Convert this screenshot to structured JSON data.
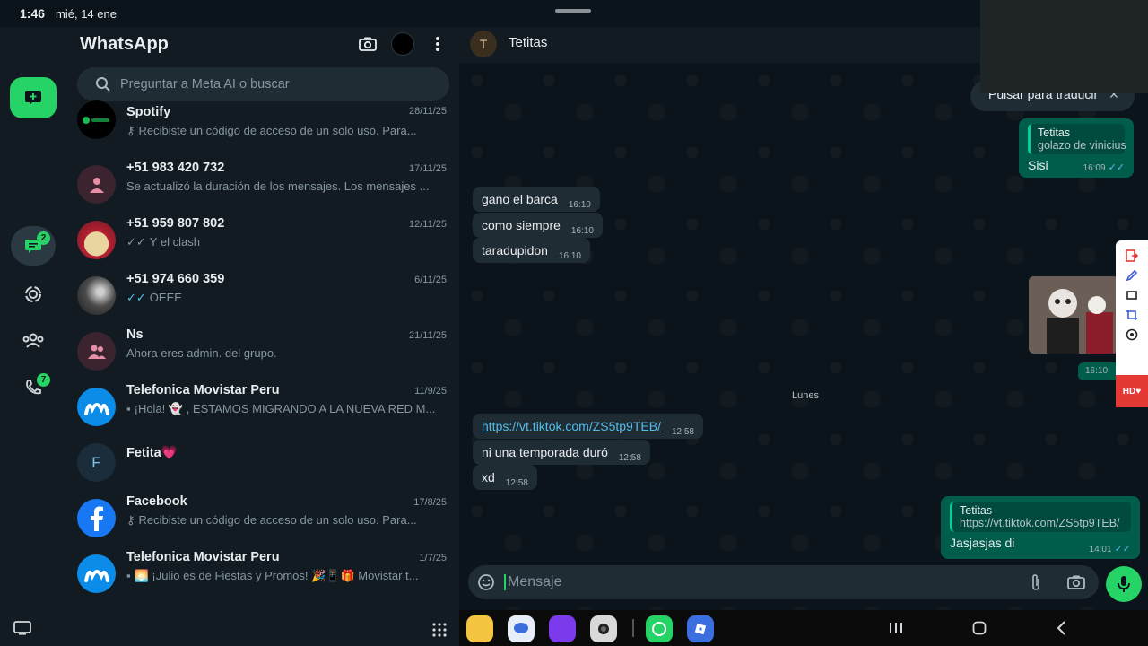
{
  "status_bar": {
    "time": "1:46",
    "date": "mié, 14 ene"
  },
  "app": {
    "title": "WhatsApp"
  },
  "rail": {
    "chats_badge": "2",
    "calls_badge": "7"
  },
  "search": {
    "placeholder": "Preguntar a Meta AI o buscar"
  },
  "chats": [
    {
      "name": "Spotify",
      "date": "28/11/25",
      "preview": "Recibiste un código de acceso de un solo uso. Para...",
      "preview_icon": "key-icon"
    },
    {
      "name": "+51 983 420 732",
      "date": "17/11/25",
      "preview": "Se actualizó la duración de los mensajes. Los mensajes ..."
    },
    {
      "name": "+51 959 807 802",
      "date": "12/11/25",
      "preview": "Y el clash",
      "preview_icon": "double-check-icon"
    },
    {
      "name": "+51 974 660 359",
      "date": "6/11/25",
      "preview": "OEEE",
      "preview_icon": "double-check-icon"
    },
    {
      "name": "Ns",
      "date": "21/11/25",
      "preview": "Ahora eres admin. del grupo."
    },
    {
      "name": "Telefonica Movistar Peru",
      "date": "11/9/25",
      "preview": "¡Hola! 👻 , ESTAMOS MIGRANDO A LA NUEVA RED M...",
      "preview_icon": "image-icon"
    },
    {
      "name": "Fetita💗",
      "date": "",
      "preview": "",
      "avatar_letter": "F"
    },
    {
      "name": "Facebook",
      "date": "17/8/25",
      "preview": "Recibiste un código de acceso de un solo uso. Para...",
      "preview_icon": "key-icon"
    },
    {
      "name": "Telefonica Movistar Peru",
      "date": "1/7/25",
      "preview": "🌅 ¡Julio es de Fiestas y Promos! 🎉📱🎁 Movistar t...",
      "preview_icon": "image-icon"
    }
  ],
  "conversation": {
    "contact_name": "Tetitas",
    "contact_initial": "T",
    "translate_prompt": "Pulsar para traducir",
    "messages": [
      {
        "dir": "out",
        "quote_name": "Tetitas",
        "quote_text": "golazo de vinicius",
        "text": "Sisi",
        "time": "16:09"
      },
      {
        "dir": "in",
        "text": "gano el barca",
        "time": "16:10"
      },
      {
        "dir": "in",
        "text": "como siempre",
        "time": "16:10"
      },
      {
        "dir": "in",
        "text": "taradupidon",
        "time": "16:10"
      },
      {
        "dir": "out",
        "kind": "photo",
        "time": "16:10"
      },
      {
        "dir": "in",
        "text": "https://vt.tiktok.com/ZS5tp9TEB/",
        "time": "12:58",
        "is_link": true
      },
      {
        "dir": "in",
        "text": "ni una temporada duró",
        "time": "12:58"
      },
      {
        "dir": "in",
        "text": "xd",
        "time": "12:58"
      },
      {
        "dir": "out",
        "quote_name": "Tetitas",
        "quote_text": "https://vt.tiktok.com/ZS5tp9TEB/",
        "text": "Jasjasjas di",
        "time": "14:01"
      }
    ],
    "date_separator": "Lunes",
    "input_placeholder": "Mensaje"
  },
  "side_tools": {
    "hd_label": "HD"
  },
  "colors": {
    "accent": "#25d366",
    "bubble_out": "#005c4b",
    "bubble_in": "#202c33",
    "background": "#0b141a",
    "link": "#53bdeb"
  }
}
